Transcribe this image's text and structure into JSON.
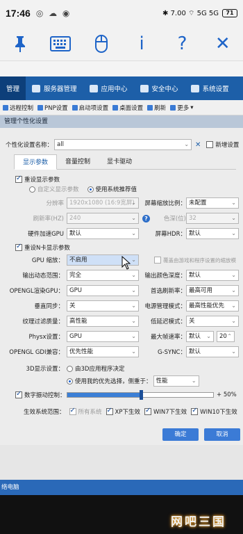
{
  "status": {
    "time": "17:46",
    "apps": "◎ ☁ ◉",
    "right": "✱ 7.00 ⌔ 5G 5G",
    "battery": "71"
  },
  "rdp_toolbar": {
    "pin_icon": "📌",
    "keyboard_icon": "⌨",
    "mouse_icon": "🖱",
    "info": "i",
    "help": "?",
    "close": "✕"
  },
  "nav": {
    "items": [
      {
        "label": "管理"
      },
      {
        "label": "服务器管理"
      },
      {
        "label": "应用中心"
      },
      {
        "label": "安全中心"
      },
      {
        "label": "系统设置"
      }
    ]
  },
  "subtool": {
    "items": [
      "远程控制",
      "PNP设置",
      "启动项设置",
      "桌面设置",
      "刷新",
      "更多"
    ]
  },
  "dialog": {
    "title": "管理个性化设置",
    "name_label": "个性化设置名称：",
    "name_value": "all",
    "new_label": "新增设置",
    "tabs": [
      "显示参数",
      "音量控制",
      "显卡驱动"
    ],
    "reset_display": "重设显示参数",
    "custom_display": "自定义显示参数",
    "use_recommended": "使用系统推荐值",
    "res_label": "分辨率",
    "res_value": "1920x1080 (16:9宽屏)",
    "scale_label": "屏幕缩放比例：",
    "scale_value": "未配置",
    "refresh_label": "刷新率(HZ)",
    "refresh_value": "240",
    "depth_label": "色深(位)",
    "depth_value": "32",
    "hwgpu_label": "硬件加速GPU",
    "hwgpu_value": "默认",
    "hdr_label": "屏幕HDR：",
    "hdr_value": "默认",
    "reset_n": "重设N卡显示参数",
    "gpuscale_label": "GPU 缩放：",
    "gpuscale_value": "不启用",
    "override_label": "覆盖由游戏和程序设置的缩放模",
    "dyn_label": "输出动态范围：",
    "dyn_value": "完全",
    "colordepth_label": "输出颜色深度：",
    "colordepth_value": "默认",
    "opengl_label": "OPENGL渲染GPU：",
    "opengl_value": "GPU",
    "pref_refresh_label": "首选刷新率：",
    "pref_refresh_value": "最高可用",
    "vsync_label": "垂直同步：",
    "vsync_value": "关",
    "power_label": "电源管理模式：",
    "power_value": "最高性能优先",
    "tex_label": "纹理过滤质量：",
    "tex_value": "高性能",
    "lowlat_label": "低延迟模式：",
    "lowlat_value": "关",
    "physx_label": "Physx设置：",
    "physx_value": "GPU",
    "maxfps_label": "最大帧速率：",
    "maxfps_value": "默认",
    "maxfps_num": "20",
    "gdi_label": "OPENGL GDI兼容：",
    "gdi_value": "优先性能",
    "gsync_label": "G-SYNC：",
    "gsync_value": "默认",
    "d3_label": "3D显示设置：",
    "d3_opt1": "由3D应用程序决定",
    "d3_opt2": "使用我的优先选择，侧重于：",
    "d3_value": "性能",
    "vibrance_label": "数字振动控制：",
    "vibrance_pct": "+ 50%",
    "vibrance_fraction": 0.5,
    "scope_label": "生效系统范围：",
    "scope_all": "所有系统",
    "scope_xp": "XP下生效",
    "scope_win7": "WIN7下生效",
    "scope_win10": "WIN10下生效",
    "ok": "确定",
    "cancel": "取消"
  },
  "taskbar": {
    "label": "络电脑"
  },
  "watermark": "网吧三国",
  "colors": {
    "nav": "#1d5fa8",
    "accent": "#3b7bd6"
  }
}
